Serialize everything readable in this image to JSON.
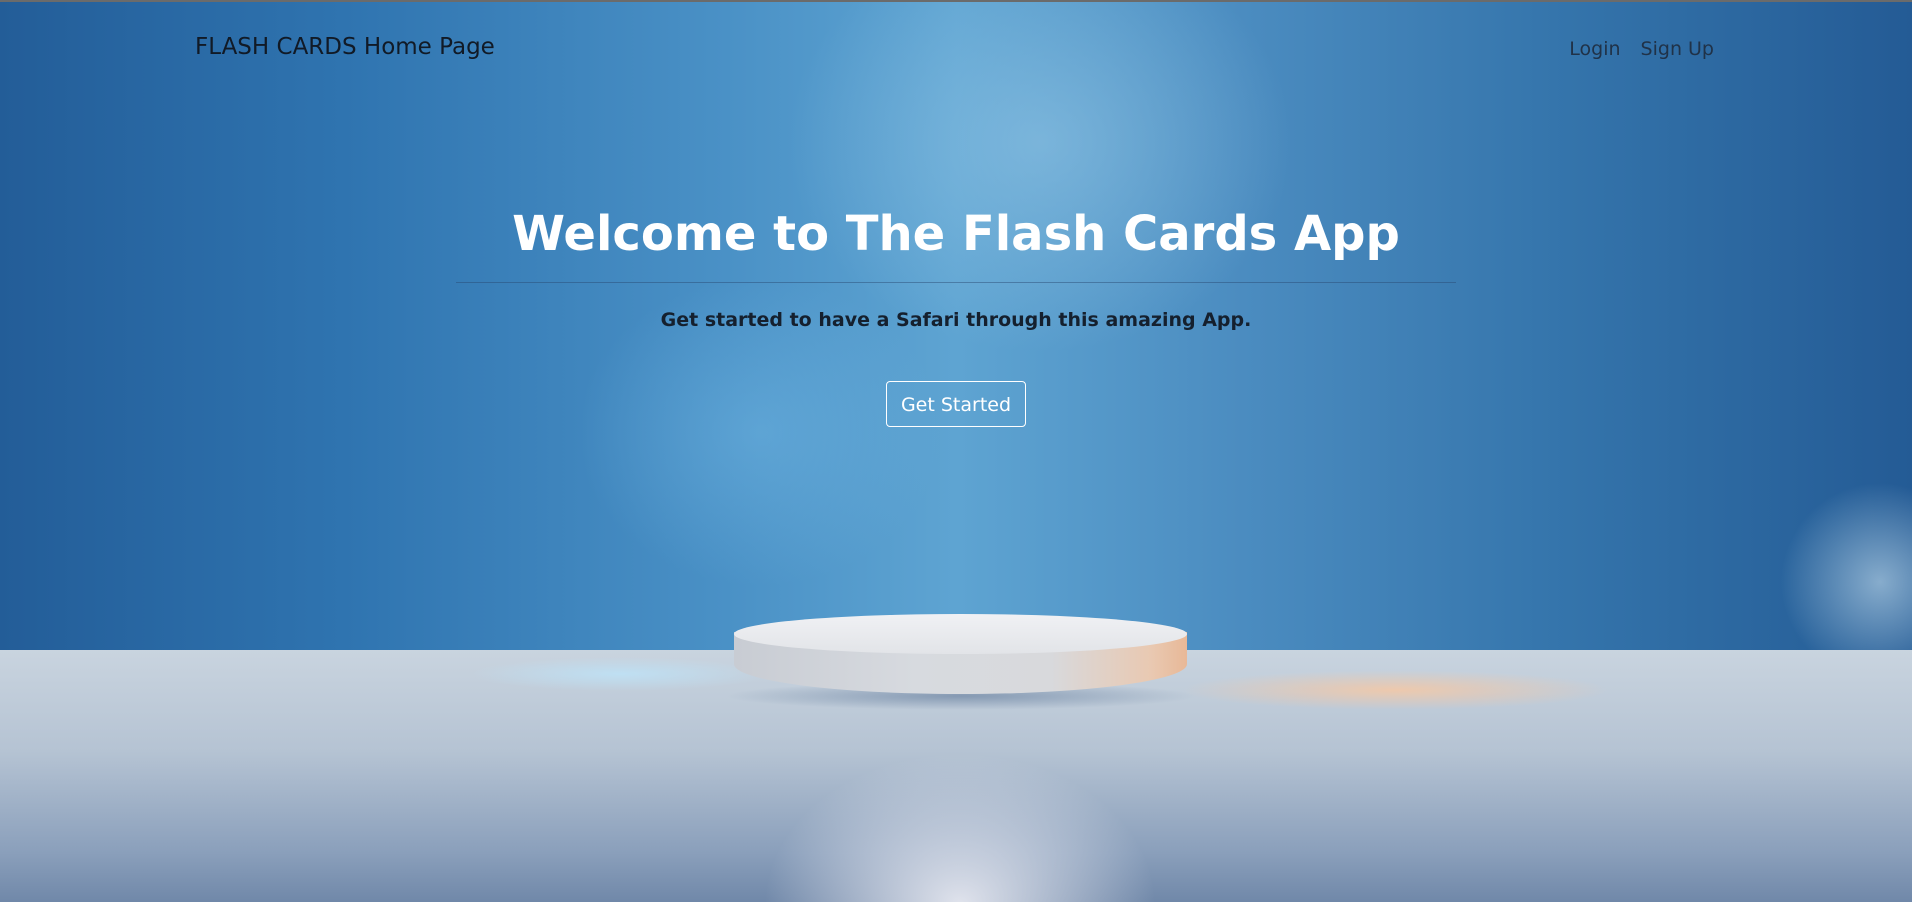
{
  "navbar": {
    "brand": "FLASH CARDS Home Page",
    "links": [
      {
        "label": "Login"
      },
      {
        "label": "Sign Up"
      }
    ]
  },
  "hero": {
    "title": "Welcome to The Flash Cards App",
    "subtitle": "Get started to have a Safari through this amazing App.",
    "cta_label": "Get Started"
  },
  "colors": {
    "background_blue": "#4a91c6",
    "title_text": "#ffffff",
    "brand_text": "#111a26",
    "button_border": "#ffffff"
  }
}
